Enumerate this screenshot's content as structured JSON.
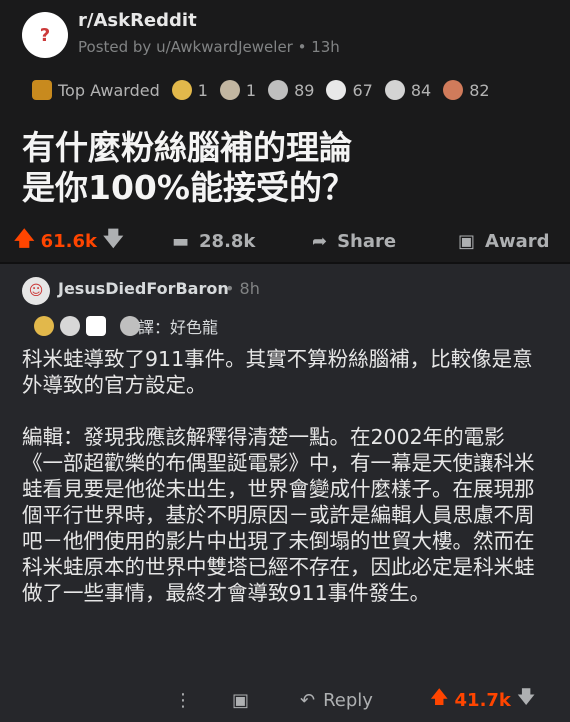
{
  "post": {
    "subreddit": "r/AskReddit",
    "posted_by": "Posted by u/AwkwardJeweler • 13h",
    "top_awarded_label": "Top Awarded",
    "awards": [
      {
        "icon": "award-flame-icon",
        "count": "1",
        "color": "#e2b84b"
      },
      {
        "icon": "award-hands-icon",
        "count": "1",
        "color": "#c2b6a1"
      },
      {
        "icon": "award-thumb-icon",
        "count": "89",
        "color": "#bfbfbf"
      },
      {
        "icon": "award-smile-icon",
        "count": "67",
        "color": "#e8e8e8"
      },
      {
        "icon": "award-silver-icon",
        "count": "84",
        "color": "#d3d3d3"
      },
      {
        "icon": "award-man-icon",
        "count": "82",
        "color": "#d07b5b"
      }
    ],
    "title_line1": "有什麼粉絲腦補的理論",
    "title_line2": "是你100%能接受的？",
    "score": "61.6k",
    "comments": "28.8k",
    "share_label": "Share",
    "award_label": "Award"
  },
  "comment": {
    "username": "JesusDiedForBaron",
    "time": "• 8h",
    "award_text": "譯：好色龍",
    "body_paragraph1": "科米蛙導致了911事件。其實不算粉絲腦補，比較像是意外導致的官方設定。",
    "body_paragraph2": "編輯：發現我應該解釋得清楚一點。在2002年的電影《一部超歡樂的布偶聖誕電影》中，有一幕是天使讓科米蛙看見要是他從未出生，世界會變成什麼樣子。在展現那個平行世界時，基於不明原因－或許是編輯人員思慮不周吧－他們使用的影片中出現了未倒塌的世貿大樓。然而在科米蛙原本的世界中雙塔已經不存在，因此必定是科米蛙做了一些事情，最終才會導致911事件發生。",
    "reply_label": "Reply",
    "score": "41.7k"
  }
}
